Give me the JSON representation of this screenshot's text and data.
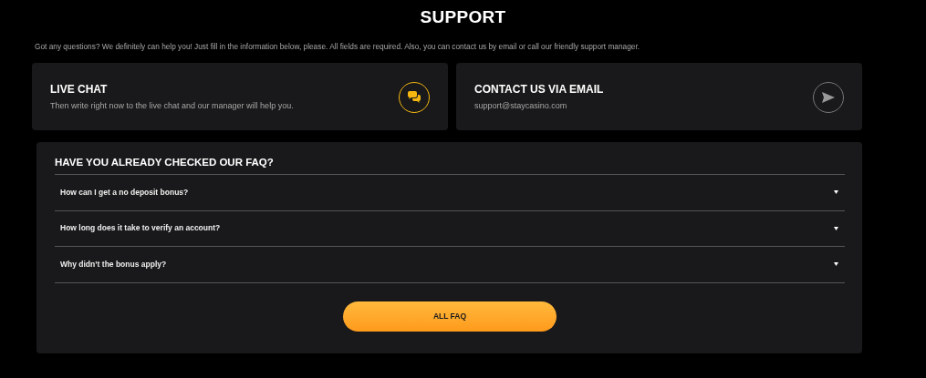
{
  "title": "SUPPORT",
  "intro": "Got any questions? We definitely can help you! Just fill in the information below, please. All fields are required. Also, you can contact us by email or call our friendly support manager.",
  "contacts": [
    {
      "kind": "chat",
      "title": "LIVE CHAT",
      "text": "Then write right now to the live chat and our manager will help you."
    },
    {
      "kind": "email",
      "title": "CONTACT US VIA EMAIL",
      "text": "support@staycasino.com"
    }
  ],
  "faq": {
    "title": "HAVE YOU ALREADY CHECKED OUR FAQ?",
    "items": [
      {
        "question": "How can I get a no deposit bonus?"
      },
      {
        "question": "How long does it take to verify an account?"
      },
      {
        "question": "Why didn’t the bonus apply?"
      }
    ],
    "button": "ALL FAQ"
  }
}
